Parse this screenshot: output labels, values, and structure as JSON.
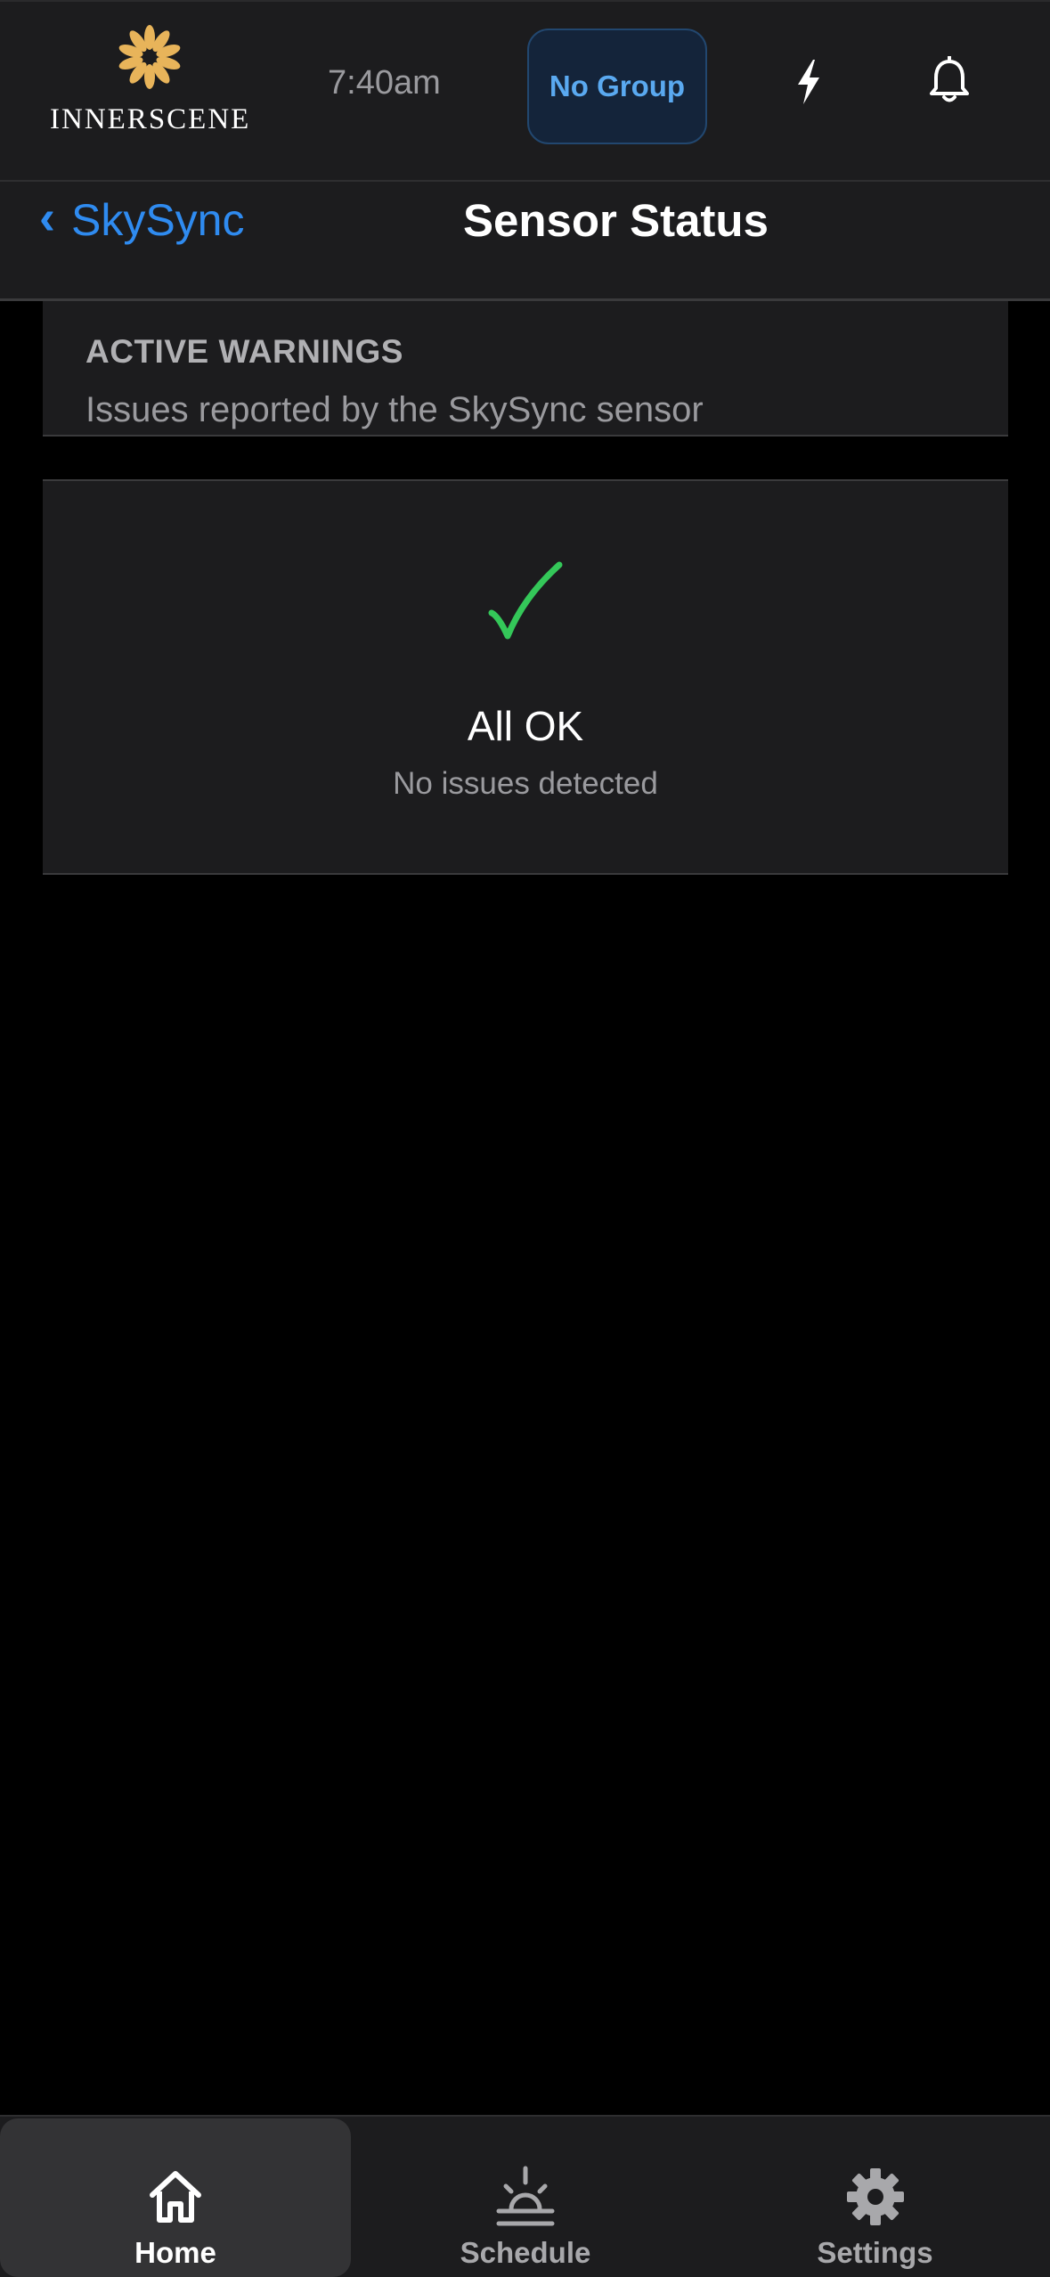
{
  "header": {
    "logo_text": "INNERSCENE",
    "time": "7:40am",
    "group_button_label": "No Group",
    "icons": [
      "lightning-icon",
      "bell-icon"
    ]
  },
  "nav": {
    "back_label": "SkySync",
    "back_chevron": "‹",
    "title": "Sensor Status"
  },
  "warnings_section": {
    "title": "ACTIVE WARNINGS",
    "subtitle": "Issues reported by the SkySync sensor"
  },
  "status": {
    "icon": "checkmark-icon",
    "title": "All OK",
    "subtitle": "No issues detected"
  },
  "tabbar": {
    "tabs": [
      {
        "label": "Home",
        "icon": "home-icon",
        "active": true
      },
      {
        "label": "Schedule",
        "icon": "sunrise-icon",
        "active": false
      },
      {
        "label": "Settings",
        "icon": "gear-icon",
        "active": false
      }
    ]
  },
  "colors": {
    "accent_blue": "#2f8bf0",
    "group_text": "#5aa9f0",
    "logo_gold": "#e8b45a",
    "check_green": "#34c759",
    "surface": "#1c1c1e",
    "background": "#000000"
  }
}
